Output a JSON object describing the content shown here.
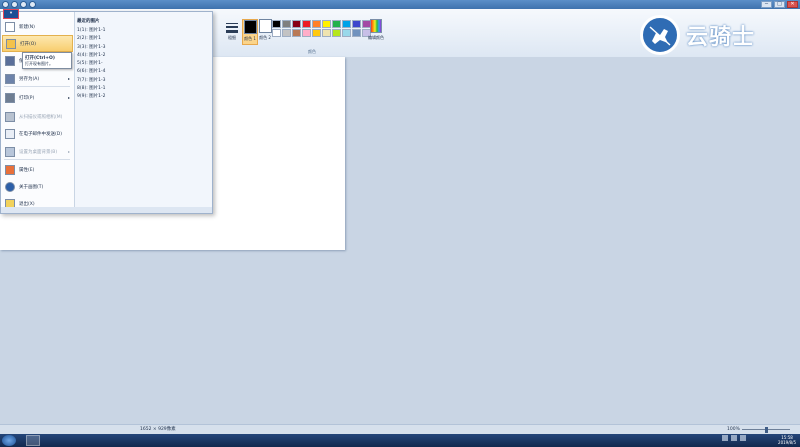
{
  "window": {
    "title": "",
    "controls": [
      "─",
      "□",
      "✕"
    ]
  },
  "ribbon": {
    "thickness_label": "粗细",
    "color1_label": "颜色 1",
    "color2_label": "颜色 2",
    "edit_colors_label": "编辑颜色",
    "colors_group_label": "颜色",
    "palette": [
      "#000000",
      "#7f7f7f",
      "#880015",
      "#ed1c24",
      "#ff7f27",
      "#fff200",
      "#22b14c",
      "#00a2e8",
      "#3f48cc",
      "#a349a4",
      "#ffffff",
      "#c3c3c3",
      "#b97a57",
      "#ffaec9",
      "#ffc90e",
      "#efe4b0",
      "#b5e61d",
      "#99d9ea",
      "#7092be",
      "#c8bfe7"
    ]
  },
  "logo": {
    "text": "云骑士"
  },
  "menu": {
    "tab_label": "▾",
    "items": [
      {
        "label": "新建(N)",
        "icon": "new-file-icon"
      },
      {
        "label": "打开(O)",
        "icon": "open-folder-icon"
      },
      {
        "label": "保存(S)",
        "icon": "save-icon"
      },
      {
        "label": "另存为(A)",
        "icon": "save-as-icon"
      },
      {
        "label": "打印(P)",
        "icon": "printer-icon"
      },
      {
        "label": "从扫描仪或照相机(M)",
        "icon": "scanner-icon"
      },
      {
        "label": "在电子邮件中发送(D)",
        "icon": "email-icon"
      },
      {
        "label": "设置为桌面背景(B)",
        "icon": "desktop-icon"
      },
      {
        "label": "属性(E)",
        "icon": "checkmark-icon"
      },
      {
        "label": "关于画图(T)",
        "icon": "info-icon"
      },
      {
        "label": "退出(X)",
        "icon": "exit-icon"
      }
    ],
    "recent_title": "最近的图片",
    "recent": [
      "1(1): 图片1-1",
      "2(2): 图片1",
      "3(3): 图片1-3",
      "4(4): 图片1-2",
      "5(5): 图片1-",
      "6(6): 图片1-4",
      "7(7): 图片1-3",
      "8(8): 图片1-1",
      "9(9): 图片1-2"
    ]
  },
  "tooltip": {
    "title": "打开(Ctrl+O)",
    "body": "打开现有图片。"
  },
  "status": {
    "size": "1652 × 929像素",
    "zoom": "100%"
  },
  "taskbar": {
    "time": "15:58",
    "date": "2019/8/5"
  }
}
